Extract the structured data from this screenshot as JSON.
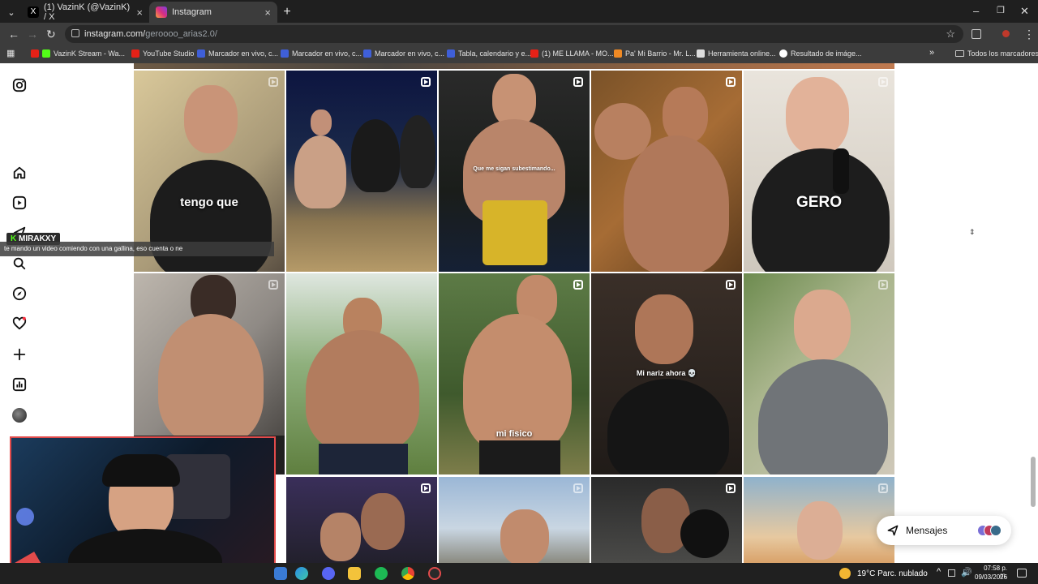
{
  "browser": {
    "tabs": [
      {
        "label": "(1) VazinK (@VazinK) / X",
        "close": "×"
      },
      {
        "label": "Instagram",
        "close": "×"
      }
    ],
    "new_tab": "+",
    "window_controls": {
      "minimize": "–",
      "restore": "❐",
      "close": "✕"
    },
    "address": {
      "host": "instagram.com/",
      "path": "geroooo_arias2.0/"
    },
    "bookmarks": [
      "VazinK Stream - Wa...",
      "YouTube Studio",
      "Marcador en vivo, c...",
      "Marcador en vivo, c...",
      "Marcador en vivo, c...",
      "Tabla, calendario y e...",
      "(1) ME LLAMA - MO...",
      "Pa' Mi Barrio - Mr. L...",
      "Herramienta online...",
      "Resultado de imáge..."
    ],
    "more_bookmarks": "»",
    "all_bookmarks": "Todos los marcadores"
  },
  "grid": {
    "captions": {
      "r1c1": "tengo que",
      "r1c3": "Que me sigan subestimando...",
      "r1c5": "GERO",
      "r2c3": "mi fisico",
      "r2c4": "Mi nariz ahora 💀"
    }
  },
  "overlay": {
    "chat_user": "MIRAKXY",
    "chat_message": "te mando un video comiendo con una gallina, eso cuenta o ne"
  },
  "messages": {
    "label": "Mensajes"
  },
  "taskbar": {
    "weather": "19°C  Parc. nublado",
    "time": "07:58 p. m.",
    "date": "09/03/2026"
  },
  "colors": {
    "accent": "#e24b4b",
    "chrome_dark": "#1f1f1f",
    "chrome_mid": "#3c3c3c"
  }
}
